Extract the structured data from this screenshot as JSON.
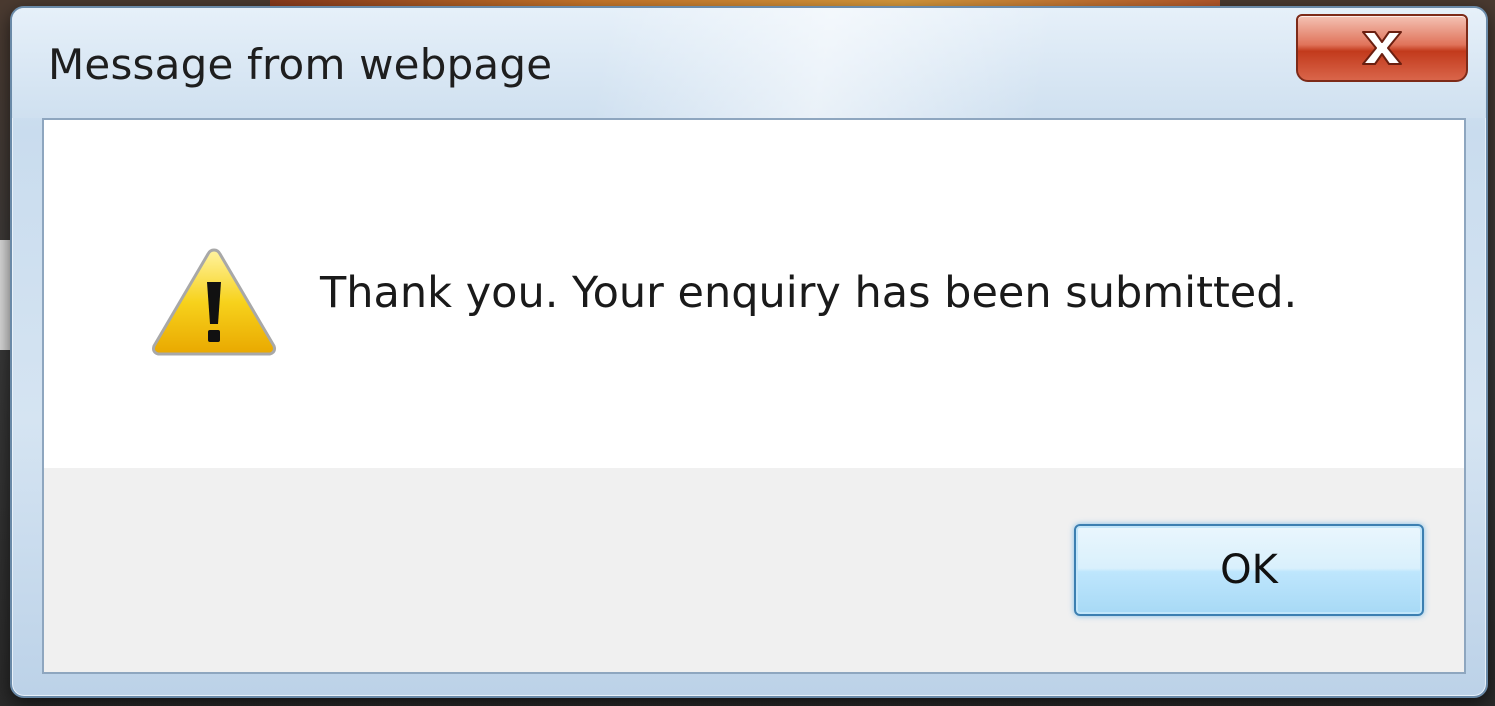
{
  "dialog": {
    "title": "Message from webpage",
    "message": "Thank you. Your enquiry has been submitted.",
    "ok_label": "OK",
    "icon": "warning-icon",
    "close_icon": "close-icon"
  },
  "colors": {
    "titlebar": "#cfe0f0",
    "close_button": "#c23a1c",
    "content_background": "#ffffff",
    "footer_background": "#f0f0f0",
    "ok_button_border": "#3c7fb1",
    "warning_yellow": "#f5c400"
  }
}
